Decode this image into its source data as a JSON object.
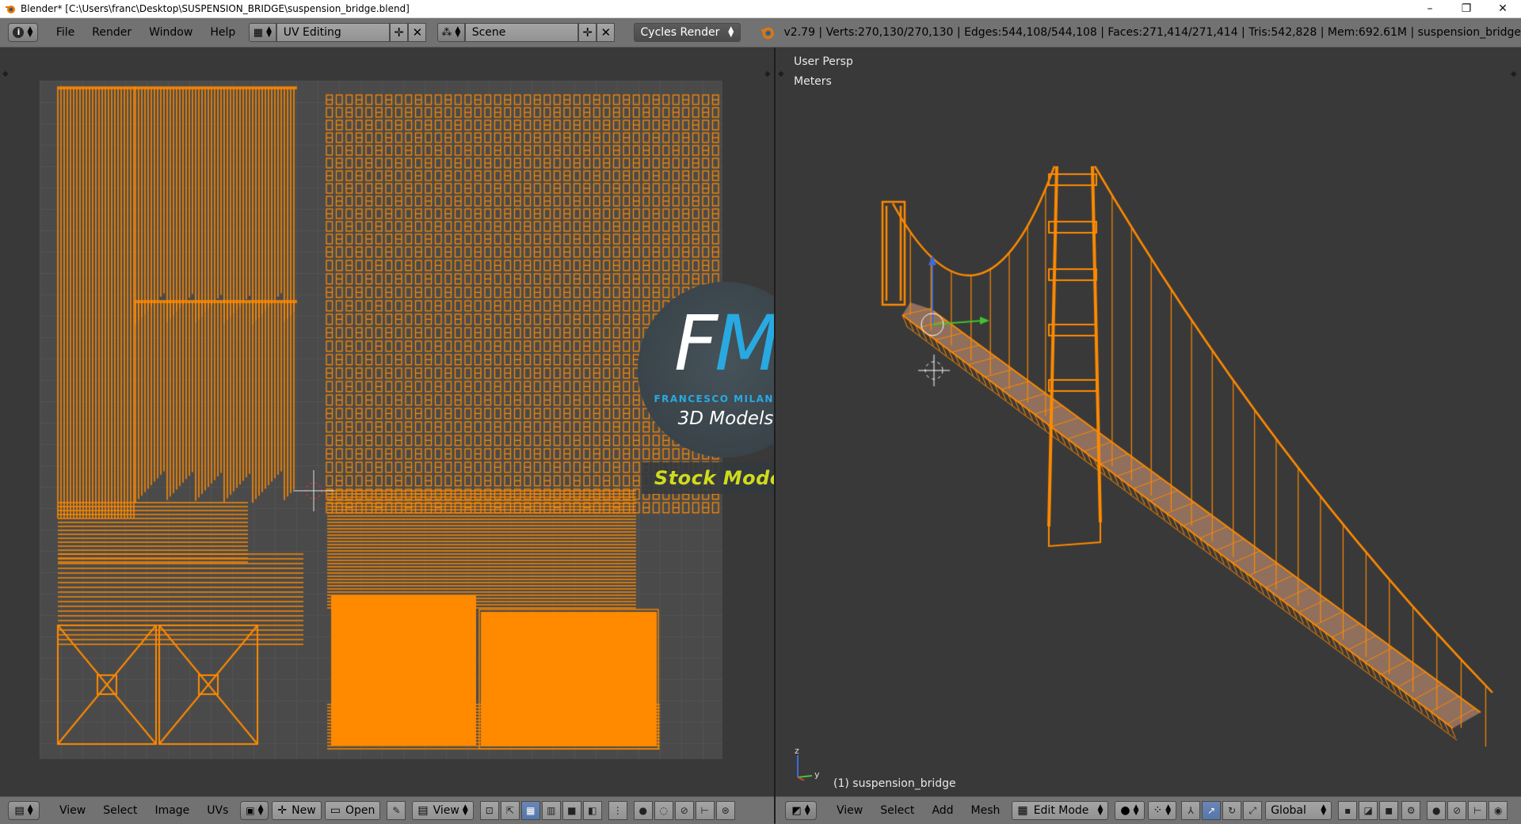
{
  "window": {
    "title": "Blender* [C:\\Users\\franc\\Desktop\\SUSPENSION_BRIDGE\\suspension_bridge.blend]",
    "minimize": "–",
    "maximize": "❐",
    "close": "✕"
  },
  "info_header": {
    "menus": [
      "File",
      "Render",
      "Window",
      "Help"
    ],
    "screen_layout": "UV Editing",
    "scene": "Scene",
    "render_engine": "Cycles Render",
    "stats": "v2.79 | Verts:270,130/270,130 | Edges:544,108/544,108 | Faces:271,414/271,414 | Tris:542,828 | Mem:692.61M | suspension_bridge"
  },
  "viewport": {
    "view_name": "User Persp",
    "units": "Meters",
    "object_label": "(1) suspension_bridge",
    "axis_z": "z",
    "axis_y": "y"
  },
  "watermark": {
    "logo_f": "F",
    "logo_m": "M",
    "author": "FRANCESCO MILANESE",
    "tagline": "3D Models",
    "banner": "Stock Models"
  },
  "uv_footer": {
    "menus": [
      "View",
      "Select",
      "Image",
      "UVs"
    ],
    "new_label": "New",
    "open_label": "Open",
    "view_label": "View"
  },
  "viewport_footer": {
    "menus": [
      "View",
      "Select",
      "Add",
      "Mesh"
    ],
    "mode": "Edit Mode",
    "orientation": "Global"
  },
  "colors": {
    "accent_orange": "#ff8a00",
    "header_gray": "#727272",
    "editor_bg": "#393939",
    "logo_blue": "#29a9e1",
    "banner_yellow": "#cfdc1c"
  }
}
